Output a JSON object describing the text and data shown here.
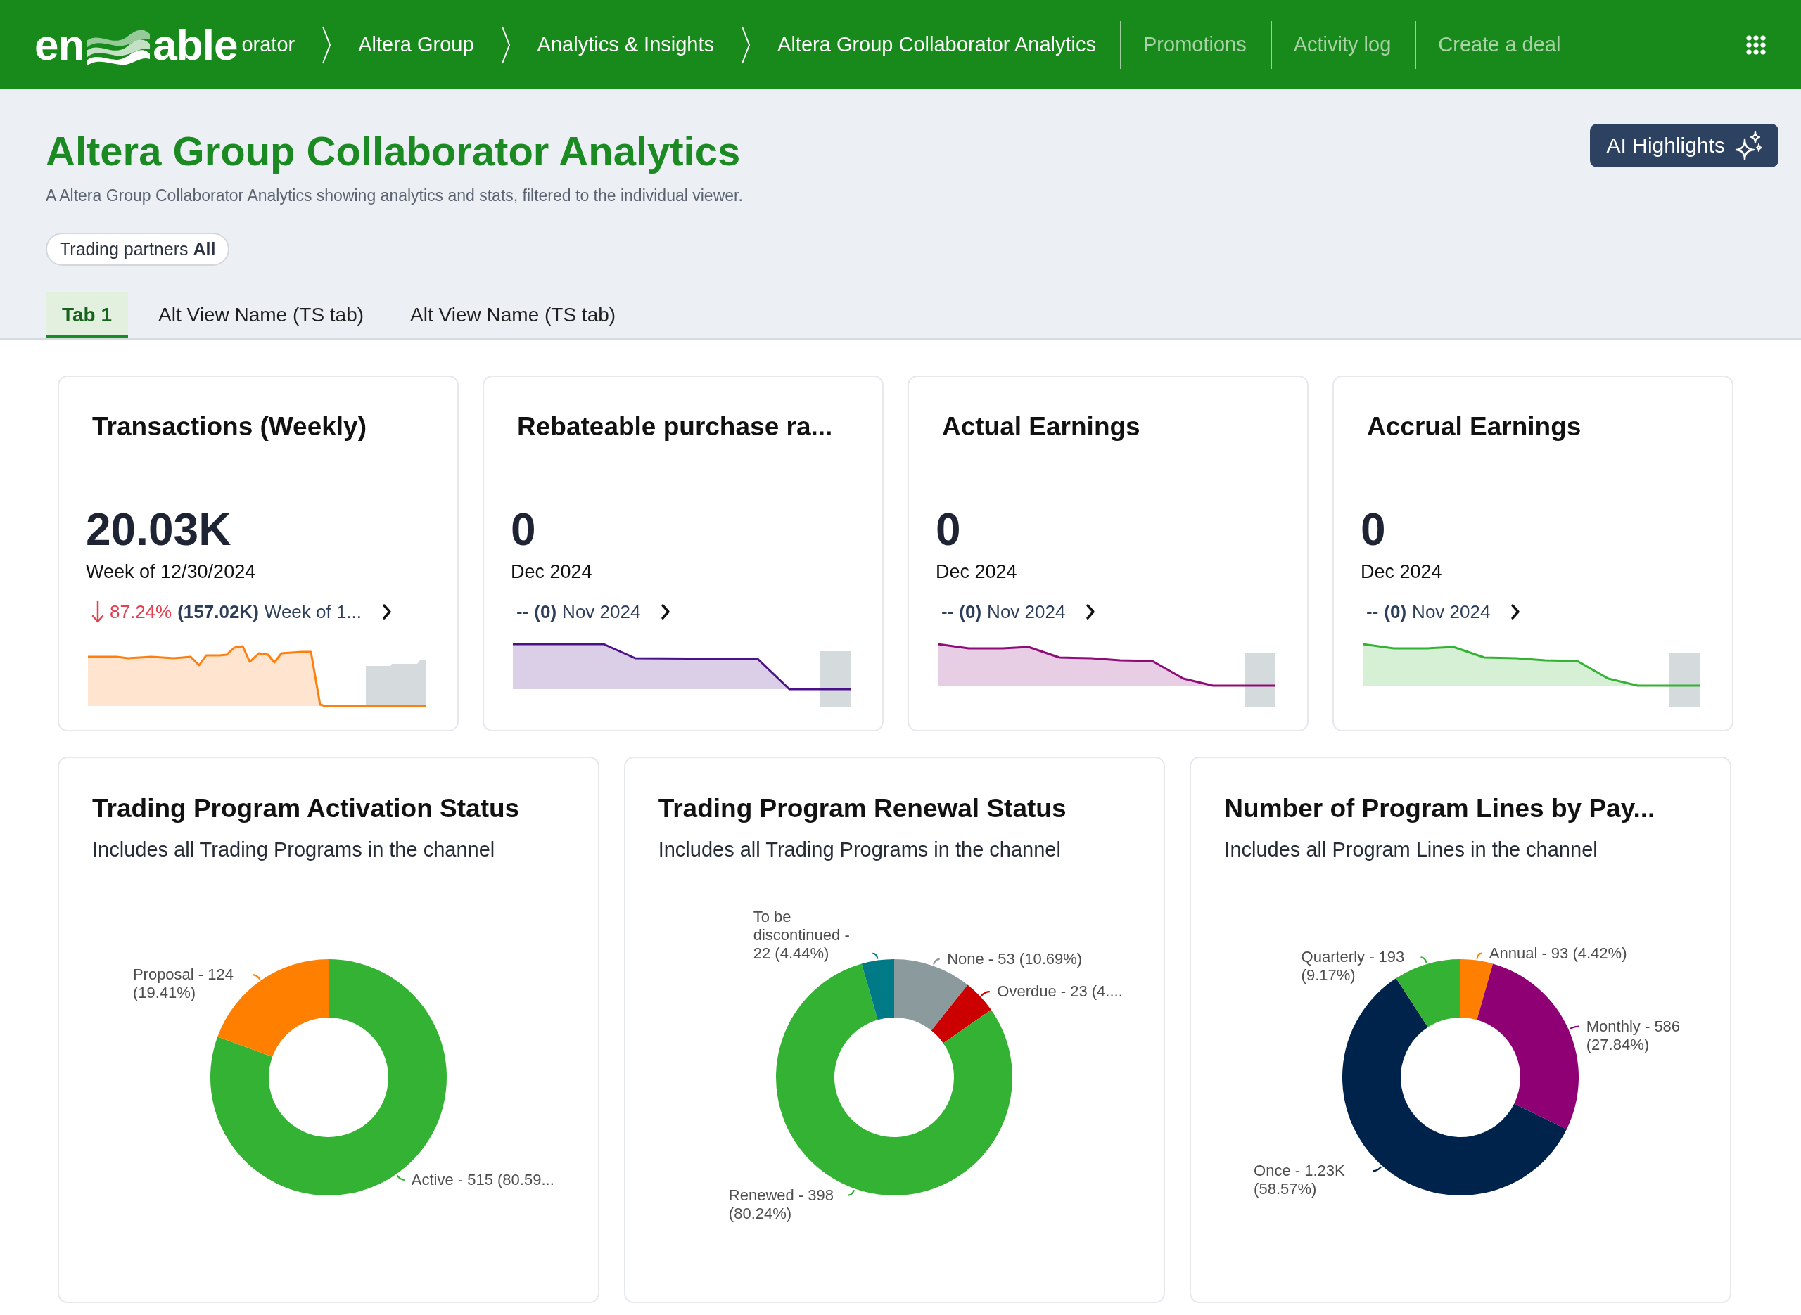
{
  "header": {
    "logo": {
      "lead": "en",
      "tail": "able"
    },
    "breadcrumbs": [
      "orator",
      "Altera Group",
      "Analytics & Insights",
      "Altera Group Collaborator Analytics"
    ],
    "nav_links": [
      "Promotions",
      "Activity log",
      "Create a deal"
    ]
  },
  "page": {
    "title": "Altera Group Collaborator Analytics",
    "description": "A Altera Group Collaborator Analytics showing analytics and stats, filtered to the individual viewer.",
    "ai_button": "AI Highlights",
    "filter_chip": {
      "label": "Trading partners",
      "value": "All"
    },
    "tabs": [
      {
        "label": "Tab 1",
        "selected": true
      },
      {
        "label": "Alt View Name (TS tab)",
        "selected": false
      },
      {
        "label": "Alt View Name (TS tab)",
        "selected": false
      }
    ]
  },
  "kpi_cards": [
    {
      "title": "Transactions (Weekly)",
      "value": "20.03K",
      "period": "Week of 12/30/2024",
      "change": {
        "kind": "down",
        "delta": "87.24%",
        "previous_value": "(157.02K)",
        "previous_period": "Week of 1..."
      },
      "kind": "weekly",
      "color": "#ff7f0e"
    },
    {
      "title": "Rebateable purchase ra...",
      "value": "0",
      "period": "Dec 2024",
      "change": {
        "kind": "none",
        "delta": "--",
        "previous_value": "(0)",
        "previous_period": "Nov 2024"
      },
      "kind": "stepped",
      "color": "#4b1189"
    },
    {
      "title": "Actual Earnings",
      "value": "0",
      "period": "Dec 2024",
      "change": {
        "kind": "none",
        "delta": "--",
        "previous_value": "(0)",
        "previous_period": "Nov 2024"
      },
      "kind": "declining",
      "color": "#8e0c78"
    },
    {
      "title": "Accrual Earnings",
      "value": "0",
      "period": "Dec 2024",
      "change": {
        "kind": "none",
        "delta": "--",
        "previous_value": "(0)",
        "previous_period": "Nov 2024"
      },
      "kind": "declining",
      "color": "#34b233"
    }
  ],
  "chart_cards": [
    {
      "title": "Trading Program Activation Status",
      "subtitle": "Includes all Trading Programs in the channel",
      "chart_data": {
        "type": "donut",
        "values": [
          80.59,
          19.41
        ],
        "colors": [
          "#34b233",
          "#ff7f00"
        ],
        "value_labels": [
          "Active - 515 (80.59...",
          "Proposal - 124 (19.41%)"
        ]
      }
    },
    {
      "title": "Trading Program Renewal Status",
      "subtitle": "Includes all Trading Programs in the channel",
      "chart_data": {
        "type": "donut",
        "values": [
          10.69,
          4.63,
          80.24,
          4.44
        ],
        "colors": [
          "#8a9a9d",
          "#cc0000",
          "#34b233",
          "#007a87"
        ],
        "value_labels": [
          "None - 53 (10.69%)",
          "Overdue - 23 (4....",
          "Renewed - 398 (80.24%)",
          "To be discontinued - 22 (4.44%)"
        ]
      }
    },
    {
      "title": "Number of Program Lines by Pay...",
      "subtitle": "Includes all Program Lines in the channel",
      "chart_data": {
        "type": "donut",
        "values": [
          4.42,
          27.84,
          58.57,
          9.17
        ],
        "colors": [
          "#ff7f00",
          "#8e0074",
          "#00234b",
          "#34b233"
        ],
        "value_labels": [
          "Annual - 93 (4.42%)",
          "Monthly - 586 (27.84%)",
          "Once - 1.23K (58.57%)",
          "Quarterly - 193 (9.17%)"
        ]
      }
    }
  ]
}
